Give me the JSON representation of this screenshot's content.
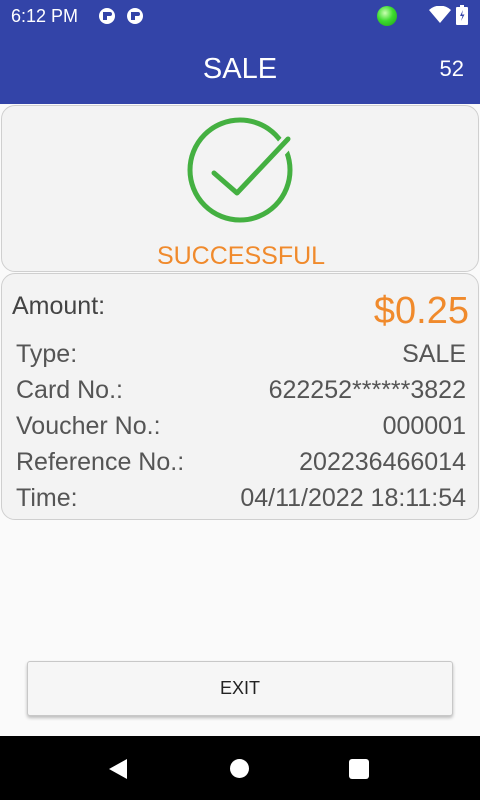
{
  "status_bar": {
    "time": "6:12 PM",
    "icons": [
      "app-notification-icon",
      "app-notification-icon",
      "green-dot-icon",
      "wifi-icon",
      "battery-icon"
    ]
  },
  "app_bar": {
    "title": "SALE",
    "counter": "52"
  },
  "result": {
    "icon": "check-circle-icon",
    "status_text": "SUCCESSFUL",
    "colors": {
      "check": "#44b041",
      "status": "#f08a2c"
    }
  },
  "details": {
    "amount_label": "Amount:",
    "amount_value": "$0.25",
    "rows": [
      {
        "label": "Type:",
        "value": "SALE"
      },
      {
        "label": "Card No.:",
        "value": "622252******3822"
      },
      {
        "label": "Voucher No.:",
        "value": "000001"
      },
      {
        "label": "Reference No.:",
        "value": "202236466014"
      },
      {
        "label": "Time:",
        "value": "04/11/2022 18:11:54"
      }
    ]
  },
  "exit_button": {
    "label": "EXIT"
  },
  "nav_bar": {
    "icons": [
      "back-icon",
      "home-icon",
      "recents-icon"
    ]
  },
  "theme": {
    "primary": "#3344a8",
    "accent": "#f08a2c"
  }
}
